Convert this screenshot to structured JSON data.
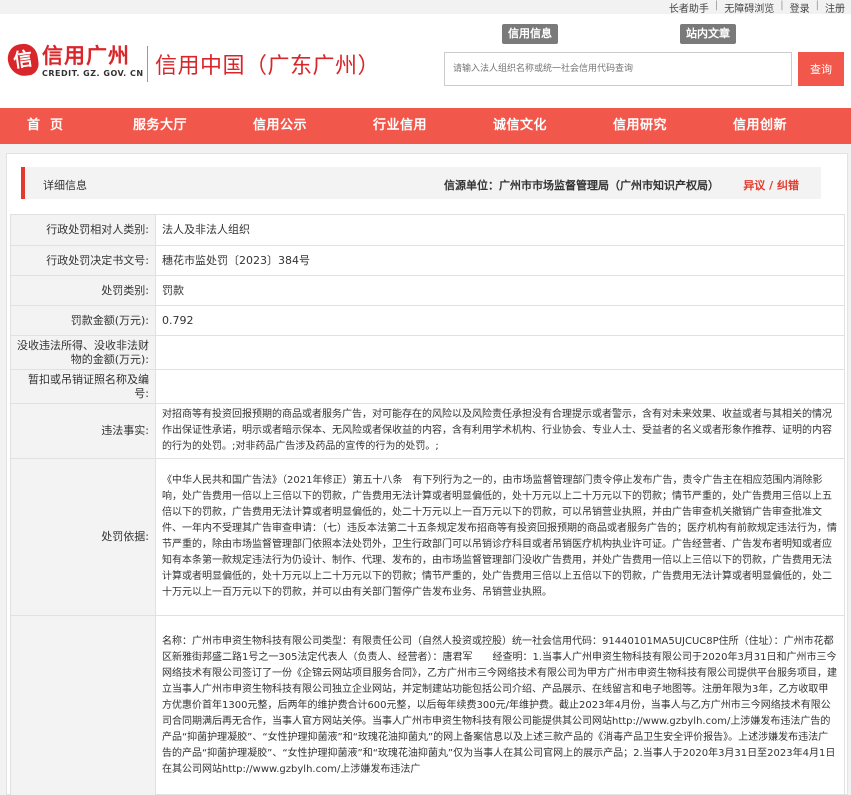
{
  "topbar": {
    "links": [
      "长者助手",
      "无障碍浏览",
      "登录",
      "注册"
    ]
  },
  "header": {
    "logo_mark": "信",
    "logo_main": "信用广州",
    "logo_sub": "CREDIT. GZ. GOV. CN",
    "site_title": "信用中国（广东广州）",
    "tab_credit": "信用信息",
    "tab_site": "站内文章",
    "search_placeholder": "请输入法人组织名称或统一社会信用代码查询",
    "search_button": "查询"
  },
  "nav": {
    "items": [
      "首页",
      "服务大厅",
      "信用公示",
      "行业信用",
      "诚信文化",
      "信用研究",
      "信用创新"
    ]
  },
  "detail": {
    "title": "详细信息",
    "source": "信源单位：广州市市场监督管理局（广州市知识产权局）",
    "objection": "异议 / 纠错"
  },
  "rows": {
    "r1": {
      "label": "行政处罚相对人类别:",
      "value": "法人及非法人组织"
    },
    "r2": {
      "label": "行政处罚决定书文号:",
      "value": "穗花市监处罚〔2023〕384号"
    },
    "r3": {
      "label": "处罚类别:",
      "value": "罚款"
    },
    "r4": {
      "label": "罚款金额(万元):",
      "value": "0.792"
    },
    "r5": {
      "label": "没收违法所得、没收非法财物的金额(万元):",
      "value": ""
    },
    "r6": {
      "label": "暂扣或吊销证照名称及编号:",
      "value": ""
    },
    "r7": {
      "label": "违法事实:",
      "value": "对招商等有投资回报预期的商品或者服务广告，对可能存在的风险以及风险责任承担没有合理提示或者警示，含有对未来效果、收益或者与其相关的情况作出保证性承诺，明示或者暗示保本、无风险或者保收益的内容，含有利用学术机构、行业协会、专业人士、受益者的名义或者形象作推荐、证明的内容的行为的处罚。;对非药品广告涉及药品的宣传的行为的处罚。;"
    },
    "r8": {
      "label": "处罚依据:",
      "value": "《中华人民共和国广告法》（2021年修正）第五十八条　有下列行为之一的，由市场监督管理部门责令停止发布广告，责令广告主在相应范围内消除影响，处广告费用一倍以上三倍以下的罚款，广告费用无法计算或者明显偏低的，处十万元以上二十万元以下的罚款；情节严重的，处广告费用三倍以上五倍以下的罚款，广告费用无法计算或者明显偏低的，处二十万元以上一百万元以下的罚款，可以吊销营业执照，并由广告审查机关撤销广告审查批准文件、一年内不受理其广告审查申请：（七）违反本法第二十五条规定发布招商等有投资回报预期的商品或者服务广告的；医疗机构有前款规定违法行为，情节严重的，除由市场监督管理部门依照本法处罚外，卫生行政部门可以吊销诊疗科目或者吊销医疗机构执业许可证。广告经营者、广告发布者明知或者应知有本条第一款规定违法行为仍设计、制作、代理、发布的，由市场监督管理部门没收广告费用，并处广告费用一倍以上三倍以下的罚款，广告费用无法计算或者明显偏低的，处十万元以上二十万元以下的罚款；情节严重的，处广告费用三倍以上五倍以下的罚款，广告费用无法计算或者明显偏低的，处二十万元以上一百万元以下的罚款，并可以由有关部门暂停广告发布业务、吊销营业执照。"
    },
    "r9": {
      "label": "",
      "value": "名称：广州市申资生物科技有限公司类型：有限责任公司（自然人投资或控股）统一社会信用代码：91440101MA5UJCUC8P住所（住址）：广州市花都区新雅街邦盛二路1号之一305法定代表人（负责人、经营者）：唐君军　　经查明：1.当事人广州申资生物科技有限公司于2020年3月31日和广州市三今网络技术有限公司签订了一份《企锦云网站项目服务合同》，乙方广州市三今网络技术有限公司为甲方广州市申资生物科技有限公司提供平台服务项目，建立当事人广州市申资生物科技有限公司独立企业网站，并定制建站功能包括公司介绍、产品展示、在线留言和电子地图等。注册年限为3年，乙方收取甲方优惠价首年1300元整，后两年的维护费合计600元整，以后每年续费300元/年维护费。截止2023年4月份，当事人与乙方广州市三今网络技术有限公司合同期满后再无合作，当事人官方网站关停。当事人广州市申资生物科技有限公司能提供其公司网站http://www.gzbylh.com/上涉嫌发布违法广告的产品“抑菌护理凝胶”、“女性护理抑菌液”和“玫瑰花油抑菌丸”的网上备案信息以及上述三款产品的《消毒产品卫生安全评价报告》。上述涉嫌发布违法广告的产品“抑菌护理凝胶”、“女性护理抑菌液”和“玫瑰花油抑菌丸”仅为当事人在其公司官网上的展示产品；2.当事人于2020年3月31日至2023年4月1日在其公司网站http://www.gzbylh.com/上涉嫌发布违法广"
    }
  }
}
